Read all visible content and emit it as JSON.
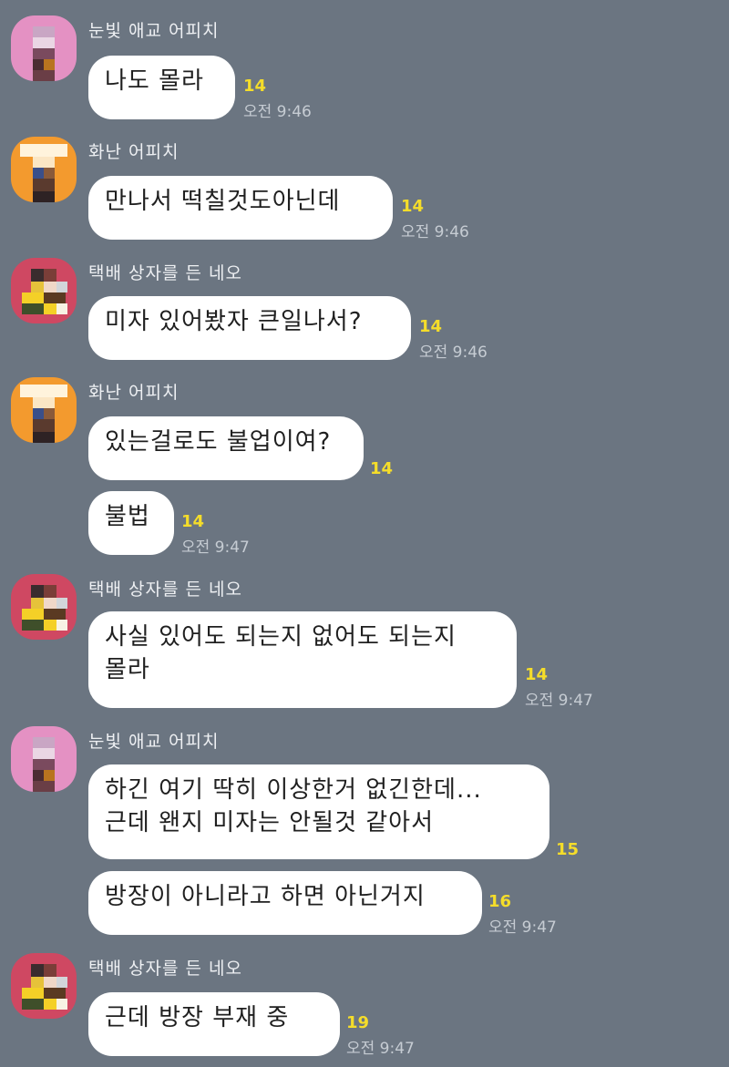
{
  "messages": [
    {
      "sender": "눈빛 애교 어피치",
      "lines": [
        "나도 몰라"
      ],
      "unread": "14",
      "time": "오전 9:46"
    },
    {
      "sender": "화난 어피치",
      "lines": [
        "만나서 떡칠것도아닌데"
      ],
      "unread": "14",
      "time": "오전 9:46"
    },
    {
      "sender": "택배 상자를 든 네오",
      "lines": [
        "미자 있어봤자 큰일나서?"
      ],
      "unread": "14",
      "time": "오전 9:46"
    },
    {
      "sender": "화난 어피치",
      "lines": [
        "있는걸로도 불업이여?"
      ],
      "unread": "14",
      "time": ""
    },
    {
      "sender": "",
      "lines": [
        "불법"
      ],
      "unread": "14",
      "time": "오전 9:47"
    },
    {
      "sender": "택배 상자를 든 네오",
      "lines": [
        "사실 있어도 되는지 없어도 되는지",
        "몰라"
      ],
      "unread": "14",
      "time": "오전 9:47"
    },
    {
      "sender": "눈빛 애교 어피치",
      "lines": [
        "하긴 여기 딱히 이상한거 없긴한데...",
        "근데 왠지 미자는 안될것 같아서"
      ],
      "unread": "15",
      "time": ""
    },
    {
      "sender": "",
      "lines": [
        "방장이 아니라고 하면 아닌거지"
      ],
      "unread": "16",
      "time": "오전 9:47"
    },
    {
      "sender": "택배 상자를 든 네오",
      "lines": [
        "근데 방장 부재 중"
      ],
      "unread": "19",
      "time": "오전 9:47"
    }
  ]
}
